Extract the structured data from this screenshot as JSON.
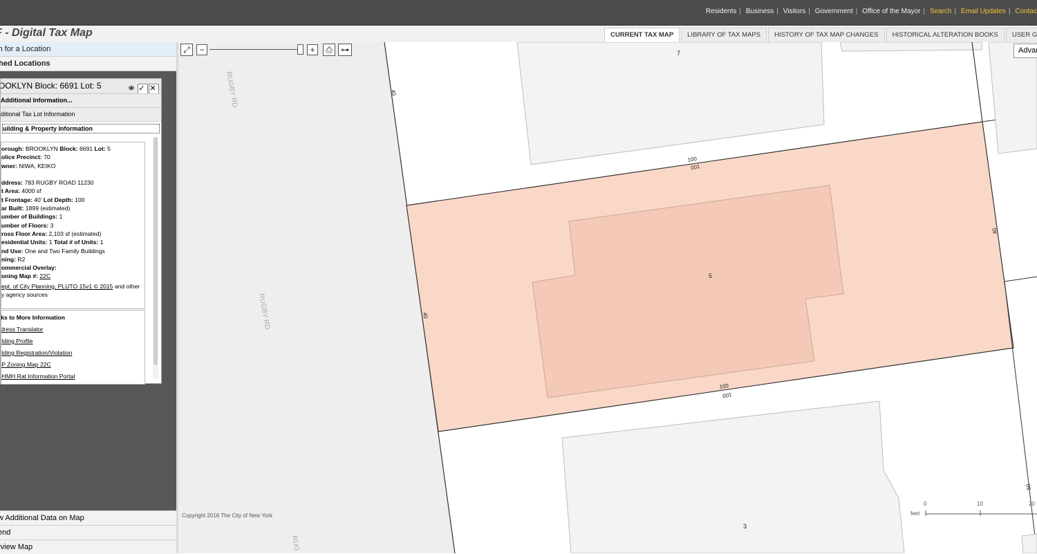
{
  "topnav": {
    "links": [
      "Residents",
      "Business",
      "Visitors",
      "Government",
      "Office of the Mayor"
    ],
    "highlight_links": [
      "Search",
      "Email Updates",
      "Contac"
    ]
  },
  "app": {
    "title": "F - Digital Tax Map"
  },
  "tabs": [
    "CURRENT TAX MAP",
    "LIBRARY OF TAX MAPS",
    "HISTORY OF TAX MAP CHANGES",
    "HISTORICAL ALTERATION BOOKS",
    "USER GU"
  ],
  "sidebar": {
    "search_label": "ch for a Location",
    "searched_label": "ched Locations",
    "result_title": "OOKLYN Block: 6691 Lot: 5",
    "add_info_label": "Additional Information...",
    "tax_lot_info_label": "ditional Tax Lot Information",
    "bldg_prop_label": "uilding & Property Information",
    "info_lines": [
      {
        "k": "orough:",
        "v": "BROOKLYN",
        "k2": "Block:",
        "v2": "6691",
        "k3": "Lot:",
        "v3": "5"
      },
      {
        "k": "olice Precinct:",
        "v": "70"
      },
      {
        "k": "wner:",
        "v": "NIWA, KEIKO"
      },
      {
        "k": "",
        "v": ""
      },
      {
        "k": "ddress:",
        "v": "783 RUGBY ROAD 11230"
      },
      {
        "k": "t Area:",
        "v": "4000 sf"
      },
      {
        "k": "t Frontage:",
        "v": "40'",
        "k2": "Lot Depth:",
        "v2": "100"
      },
      {
        "k": "ar Built:",
        "v": "1899 (estimated)"
      },
      {
        "k": "umber of Buildings:",
        "v": "1"
      },
      {
        "k": "umber of Floors:",
        "v": "3"
      },
      {
        "k": "ross Floor Area:",
        "v": "2,103 sf (estimated)"
      },
      {
        "k": "esidential Units:",
        "v": "1",
        "k2": "Total # of Units:",
        "v2": "1"
      },
      {
        "k": "nd Use:",
        "v": "One and Two Family Buildings"
      },
      {
        "k": "ning:",
        "v": "R2"
      },
      {
        "k": "ommercial Overlay:",
        "v": ""
      },
      {
        "k": "oning Map #:",
        "v": "22C"
      }
    ],
    "source_link": "ept. of City Planning, PLUTO 15v1 © 2015",
    "source_tail": "and other",
    "source_line2": "y agency sources",
    "links_title": "nks to More Information",
    "links": [
      "ddress Translator",
      "uilding Profile",
      "uilding Registration/Violation",
      "CP Zoning Map 22C",
      "OHMH Rat Information Portal"
    ],
    "bottom_items": [
      "w Additional Data on Map",
      "end",
      "rview Map"
    ]
  },
  "map": {
    "adv_button": "Advan",
    "copyright": "Copyright 2016 The City of New York",
    "street_labels": [
      "RUGBY RD",
      "RUGBY RD",
      "RUG"
    ],
    "lot_labels": [
      "7",
      "5",
      "3"
    ],
    "dim_labels": [
      "40",
      "40",
      "40",
      "100",
      "100",
      "100",
      "100",
      "50"
    ],
    "scale": {
      "unit": "feet",
      "ticks": [
        "0",
        "10",
        "20"
      ]
    }
  },
  "colors": {
    "topbar": "#4c4c4c",
    "sidebar": "#575757",
    "lot_selected": "#fad8c8",
    "building_selected": "#f5c9b7",
    "street": "#eeeeee",
    "building": "#f3f3f3",
    "accent": "#f3c13a"
  },
  "icons": [
    "zoom-extent-icon",
    "zoom-out-icon",
    "zoom-in-icon",
    "print-icon",
    "measure-icon",
    "binoculars-icon",
    "check-icon",
    "close-icon"
  ]
}
